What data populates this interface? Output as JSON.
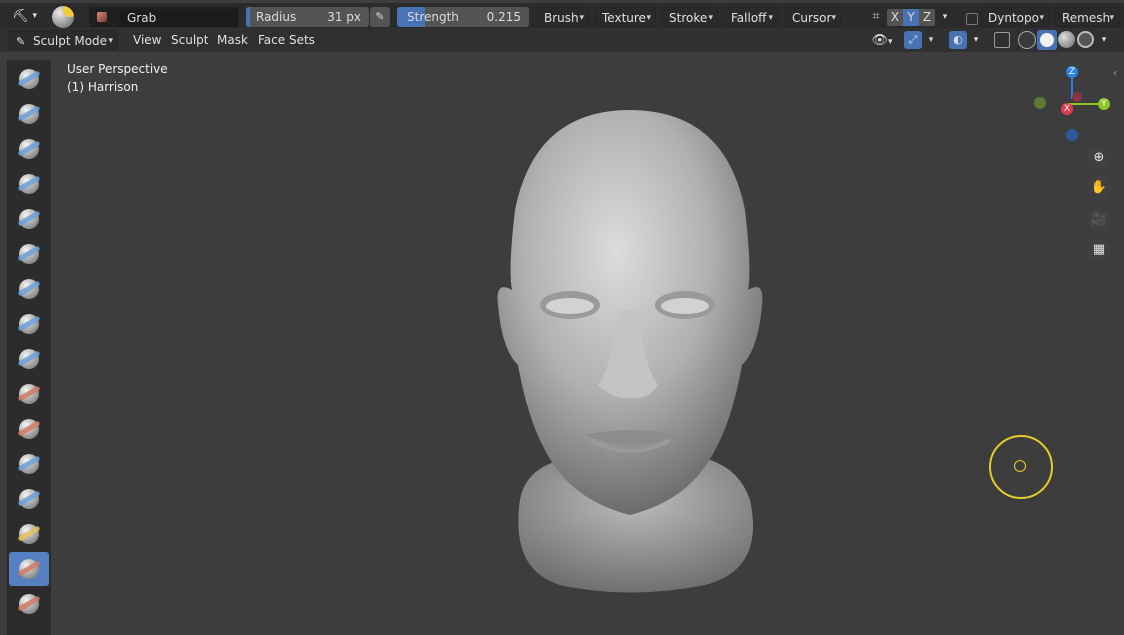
{
  "topbar": {
    "brush_name": "Grab",
    "radius": {
      "label": "Radius",
      "value": "31 px"
    },
    "strength": {
      "label": "Strength",
      "value": "0.215",
      "fraction": 0.215
    },
    "menus": [
      "Brush",
      "Texture",
      "Stroke",
      "Falloff",
      "Cursor"
    ],
    "axes": [
      "X",
      "Y",
      "Z"
    ],
    "dyntopo": "Dyntopo",
    "remesh": "Remesh"
  },
  "modebar": {
    "mode": "Sculpt Mode",
    "menus": [
      "View",
      "Sculpt",
      "Mask",
      "Face Sets"
    ]
  },
  "viewport": {
    "perspective": "User Perspective",
    "object": "(1) Harrison"
  },
  "gizmo": {
    "x": "X",
    "y": "Y",
    "z": "Z"
  },
  "tools": [
    "draw",
    "draw-sharp",
    "clay",
    "clay-strips",
    "layer",
    "inflate",
    "blob",
    "crease",
    "smooth",
    "flatten",
    "fill",
    "scrape",
    "pinch",
    "grab",
    "snake-hook",
    "thumb",
    "nudge"
  ],
  "colors": {
    "accent": "#4772b3",
    "active_tool": "#5680c2",
    "cursor_circle": "#e6cc2a"
  }
}
